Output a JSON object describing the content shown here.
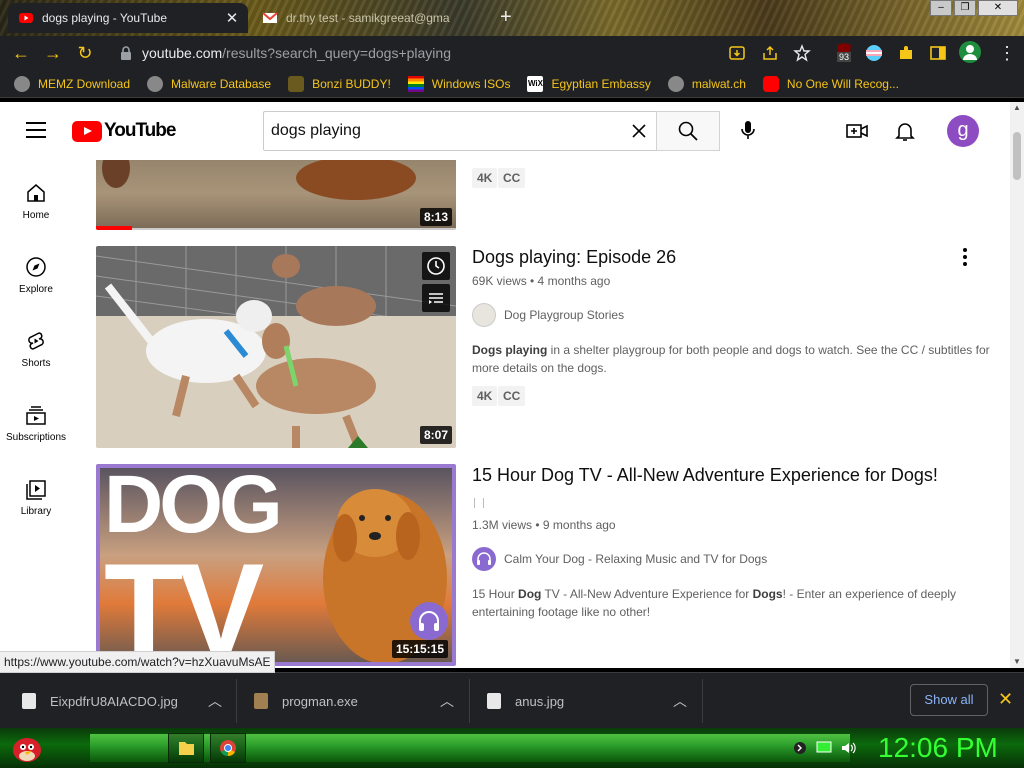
{
  "browser": {
    "tabs": [
      {
        "title": "dogs playing - YouTube",
        "active": true
      },
      {
        "title": "dr.thy test - samikgreeat@gma",
        "active": false
      }
    ],
    "url_domain": "youtube.com",
    "url_path": "/results?search_query=dogs+playing",
    "extension_badge": "93",
    "bookmarks": [
      "MEMZ Download",
      "Malware Database",
      "Bonzi BUDDY!",
      "Windows ISOs",
      "Egyptian Embassy",
      "malwat.ch",
      "No One Will Recog..."
    ],
    "status_url": "https://www.youtube.com/watch?v=hzXuavuMsAE"
  },
  "youtube": {
    "logo_text": "YouTube",
    "search_value": "dogs playing",
    "avatar_letter": "g",
    "guide": [
      "Home",
      "Explore",
      "Shorts",
      "Subscriptions",
      "Library"
    ],
    "results": [
      {
        "duration": "8:13",
        "badges": [
          "4K",
          "CC"
        ],
        "progress": 0.1
      },
      {
        "title": "Dogs playing: Episode 26",
        "meta": "69K views • 4 months ago",
        "channel": "Dog Playgroup Stories",
        "desc_bold": "Dogs playing",
        "desc_rest": " in a shelter playgroup for both people and dogs to watch. See the CC / subtitles for more details on the dogs.",
        "badges": [
          "4K",
          "CC"
        ],
        "duration": "8:07"
      },
      {
        "title": "15 Hour Dog TV - All-New Adventure Experience for Dogs!",
        "meta": "1.3M views • 9 months ago",
        "channel": "Calm Your Dog - Relaxing Music and TV for Dogs",
        "desc_parts": [
          "15 Hour ",
          "Dog",
          " TV - All-New Adventure Experience for ",
          "Dogs",
          "! - Enter an experience of deeply entertaining footage like no other!"
        ],
        "thumb_text_1": "DOG",
        "thumb_text_2": "TV",
        "duration": "15:15:15"
      }
    ]
  },
  "downloads": {
    "items": [
      "EixpdfrU8AIACDO.jpg",
      "progman.exe",
      "anus.jpg"
    ],
    "show_all": "Show all"
  },
  "taskbar": {
    "clock": "12:06 PM"
  },
  "colors": {
    "accent_yellow": "#f5c518",
    "yt_red": "#ff0000",
    "taskbar_green": "#33ff33"
  }
}
